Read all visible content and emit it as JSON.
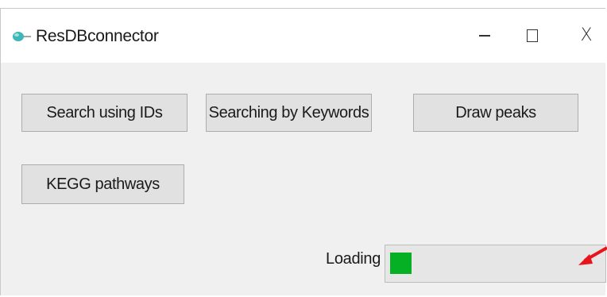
{
  "window": {
    "title": "ResDBconnector",
    "icon": "app-logo-icon",
    "controls": {
      "minimize": "minimize-icon",
      "maximize": "maximize-icon",
      "close_label": "X"
    }
  },
  "buttons": {
    "search_ids": "Search using IDs",
    "search_keywords": "Searching by Keywords",
    "draw_peaks": "Draw peaks",
    "kegg_pathways": "KEGG pathways"
  },
  "loading": {
    "label": "Loading",
    "progress_fraction": 0.1,
    "fill_color": "#06b025"
  },
  "annotation": {
    "arrow_color": "#e8141c"
  }
}
